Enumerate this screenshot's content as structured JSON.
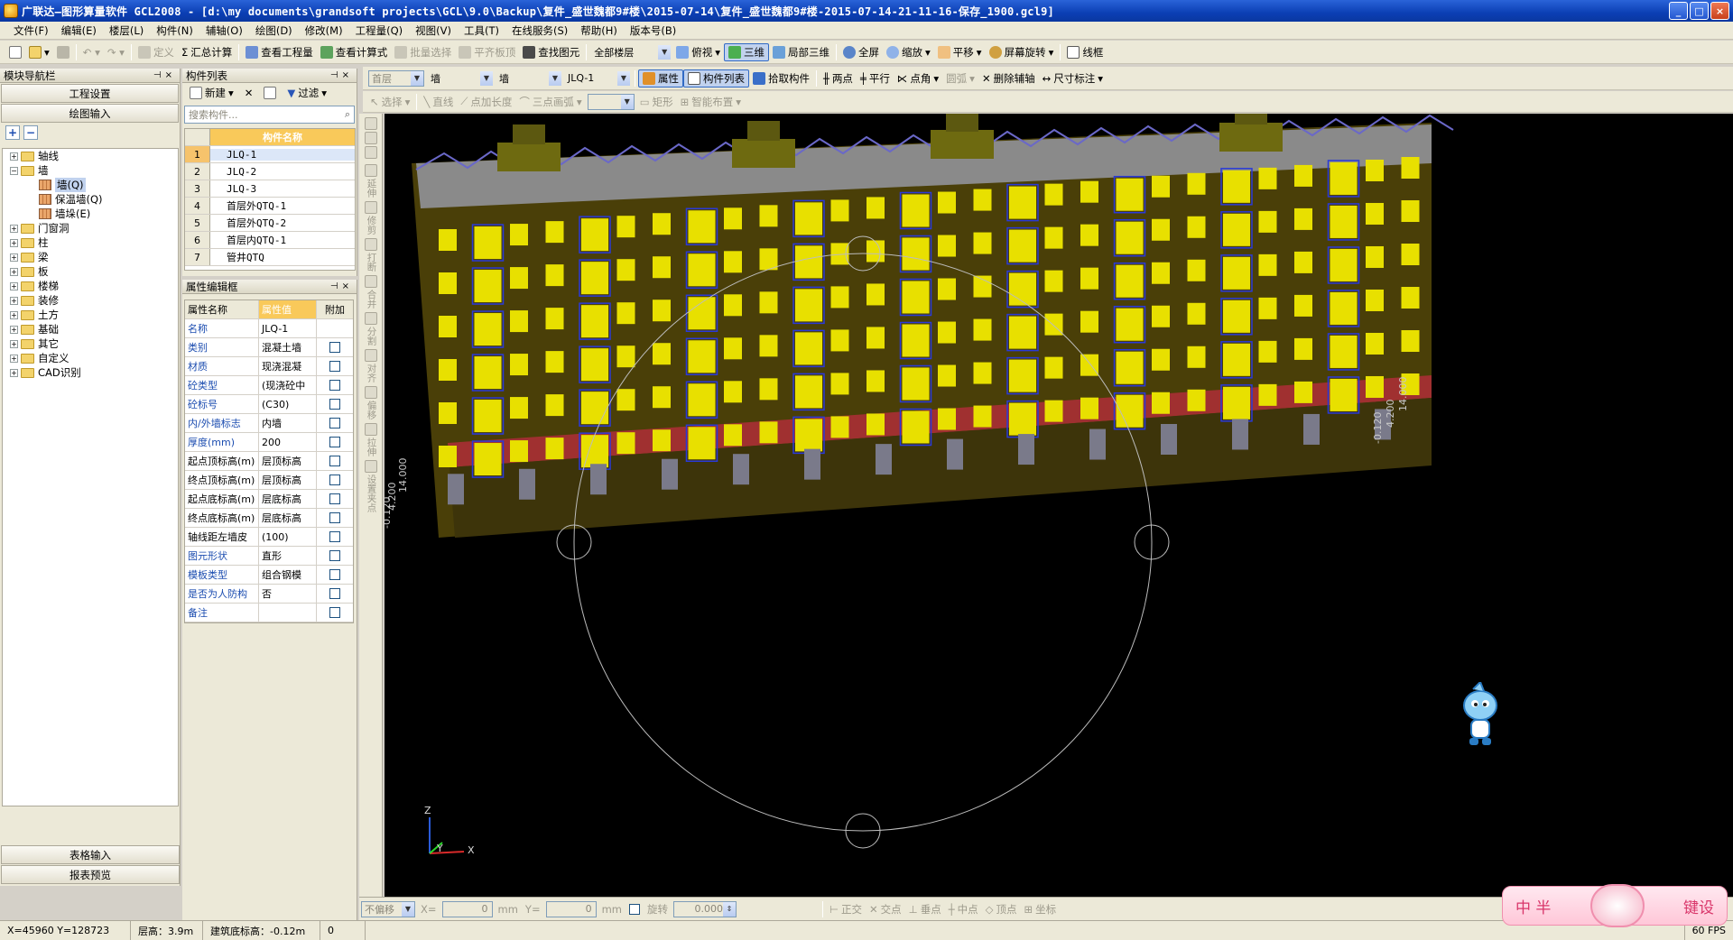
{
  "window": {
    "title": "广联达—图形算量软件 GCL2008 - [d:\\my documents\\grandsoft projects\\GCL\\9.0\\Backup\\复件_盛世魏都9#楼\\2015-07-14\\复件_盛世魏都9#楼-2015-07-14-21-11-16-保存_1900.gcl9]",
    "controls": [
      "_",
      "□",
      "×"
    ]
  },
  "menu": [
    "文件(F)",
    "编辑(E)",
    "楼层(L)",
    "构件(N)",
    "辅轴(O)",
    "绘图(D)",
    "修改(M)",
    "工程量(Q)",
    "视图(V)",
    "工具(T)",
    "在线服务(S)",
    "帮助(H)",
    "版本号(B)"
  ],
  "toolbar1": {
    "items": [
      "定义",
      "汇总计算",
      "查看工程量",
      "查看计算式",
      "批量选择",
      "平齐板顶",
      "查找图元"
    ],
    "floor_select": "全部楼层",
    "view_items": [
      "俯视",
      "三维",
      "局部三维",
      "全屏",
      "缩放",
      "平移",
      "屏幕旋转",
      "线框"
    ]
  },
  "toolbar2": {
    "floor": "首层",
    "type1": "墙",
    "type2": "墙",
    "component": "JLQ-1",
    "buttons": [
      "属性",
      "构件列表",
      "拾取构件",
      "两点",
      "平行",
      "点角",
      "圆弧",
      "删除辅轴",
      "尺寸标注"
    ]
  },
  "toolbar3": {
    "items": [
      "选择",
      "直线",
      "点加长度",
      "三点画弧",
      "矩形",
      "智能布置"
    ]
  },
  "nav_panel": {
    "title": "模块导航栏",
    "buttons": [
      "工程设置",
      "绘图输入"
    ],
    "footer_buttons": [
      "表格输入",
      "报表预览"
    ],
    "tree": [
      {
        "label": "轴线",
        "level": 0,
        "expanded": false
      },
      {
        "label": "墙",
        "level": 0,
        "expanded": true
      },
      {
        "label": "墙(Q)",
        "level": 1,
        "selected": true
      },
      {
        "label": "保温墙(Q)",
        "level": 1
      },
      {
        "label": "墙垛(E)",
        "level": 1
      },
      {
        "label": "门窗洞",
        "level": 0,
        "expanded": false
      },
      {
        "label": "柱",
        "level": 0,
        "expanded": false
      },
      {
        "label": "梁",
        "level": 0,
        "expanded": false
      },
      {
        "label": "板",
        "level": 0,
        "expanded": false
      },
      {
        "label": "楼梯",
        "level": 0,
        "expanded": false
      },
      {
        "label": "装修",
        "level": 0,
        "expanded": false
      },
      {
        "label": "土方",
        "level": 0,
        "expanded": false
      },
      {
        "label": "基础",
        "level": 0,
        "expanded": false
      },
      {
        "label": "其它",
        "level": 0,
        "expanded": false
      },
      {
        "label": "自定义",
        "level": 0,
        "expanded": false
      },
      {
        "label": "CAD识别",
        "level": 0,
        "expanded": false
      }
    ]
  },
  "component_list": {
    "title": "构件列表",
    "new_label": "新建",
    "filter_label": "过滤",
    "search_placeholder": "搜索构件...",
    "column_header": "构件名称",
    "rows": [
      "JLQ-1",
      "JLQ-2",
      "JLQ-3",
      "首层外QTQ-1",
      "首层外QTQ-2",
      "首层内QTQ-1",
      "管井QTQ"
    ]
  },
  "property_panel": {
    "title": "属性编辑框",
    "headers": [
      "属性名称",
      "属性值",
      "附加"
    ],
    "rows": [
      {
        "name": "名称",
        "value": "JLQ-1",
        "blue": true,
        "check": false
      },
      {
        "name": "类别",
        "value": "混凝土墙",
        "blue": true,
        "check": true
      },
      {
        "name": "材质",
        "value": "现浇混凝",
        "blue": true,
        "check": true
      },
      {
        "name": "砼类型",
        "value": "(现浇砼中",
        "blue": true,
        "check": true
      },
      {
        "name": "砼标号",
        "value": "(C30)",
        "blue": true,
        "check": true
      },
      {
        "name": "内/外墙标志",
        "value": "内墙",
        "blue": true,
        "check": true
      },
      {
        "name": "厚度(mm)",
        "value": "200",
        "blue": true,
        "check": true
      },
      {
        "name": "起点顶标高(m)",
        "value": "层顶标高",
        "blue": false,
        "check": true
      },
      {
        "name": "终点顶标高(m)",
        "value": "层顶标高",
        "blue": false,
        "check": true
      },
      {
        "name": "起点底标高(m)",
        "value": "层底标高",
        "blue": false,
        "check": true
      },
      {
        "name": "终点底标高(m)",
        "value": "层底标高",
        "blue": false,
        "check": true
      },
      {
        "name": "轴线距左墙皮",
        "value": "(100)",
        "blue": false,
        "check": true
      },
      {
        "name": "图元形状",
        "value": "直形",
        "blue": true,
        "check": true
      },
      {
        "name": "模板类型",
        "value": "组合钢模",
        "blue": true,
        "check": true
      },
      {
        "name": "是否为人防构",
        "value": "否",
        "blue": true,
        "check": true
      },
      {
        "name": "备注",
        "value": "",
        "blue": true,
        "check": true
      }
    ]
  },
  "vertical_tools": [
    "延伸",
    "修剪",
    "打断",
    "合并",
    "分割",
    "对齐",
    "偏移",
    "拉伸",
    "设置夹点"
  ],
  "viewport": {
    "dim_left": [
      "14.000",
      "4.200",
      "-0.120"
    ],
    "dim_right": [
      "14.000",
      "4.200",
      "-0.120"
    ],
    "axis_labels": [
      "Z",
      "Y",
      "X"
    ]
  },
  "coord_bar": {
    "mode": "不偏移",
    "x_label": "X=",
    "x_value": "0",
    "y_label": "Y=",
    "y_value": "0",
    "unit": "mm",
    "rotate_label": "旋转",
    "rotate_value": "0.000",
    "snap_items": [
      "正交",
      "交点",
      "垂点",
      "中点",
      "顶点",
      "坐标"
    ]
  },
  "status_bar": {
    "coords": "X=45960 Y=128723",
    "floor_height": "层高：3.9m",
    "base_elev": "建筑底标高：-0.12m",
    "value": "0",
    "fps": "60 FPS"
  },
  "ime": {
    "left": "中 半",
    "right": "键设"
  },
  "colors": {
    "title": "#0b3fb4",
    "panel": "#ece9d8",
    "viewport": "#000000",
    "wall": "#4a3f08",
    "window": "#e8e000",
    "accent": "#f9c95a"
  }
}
